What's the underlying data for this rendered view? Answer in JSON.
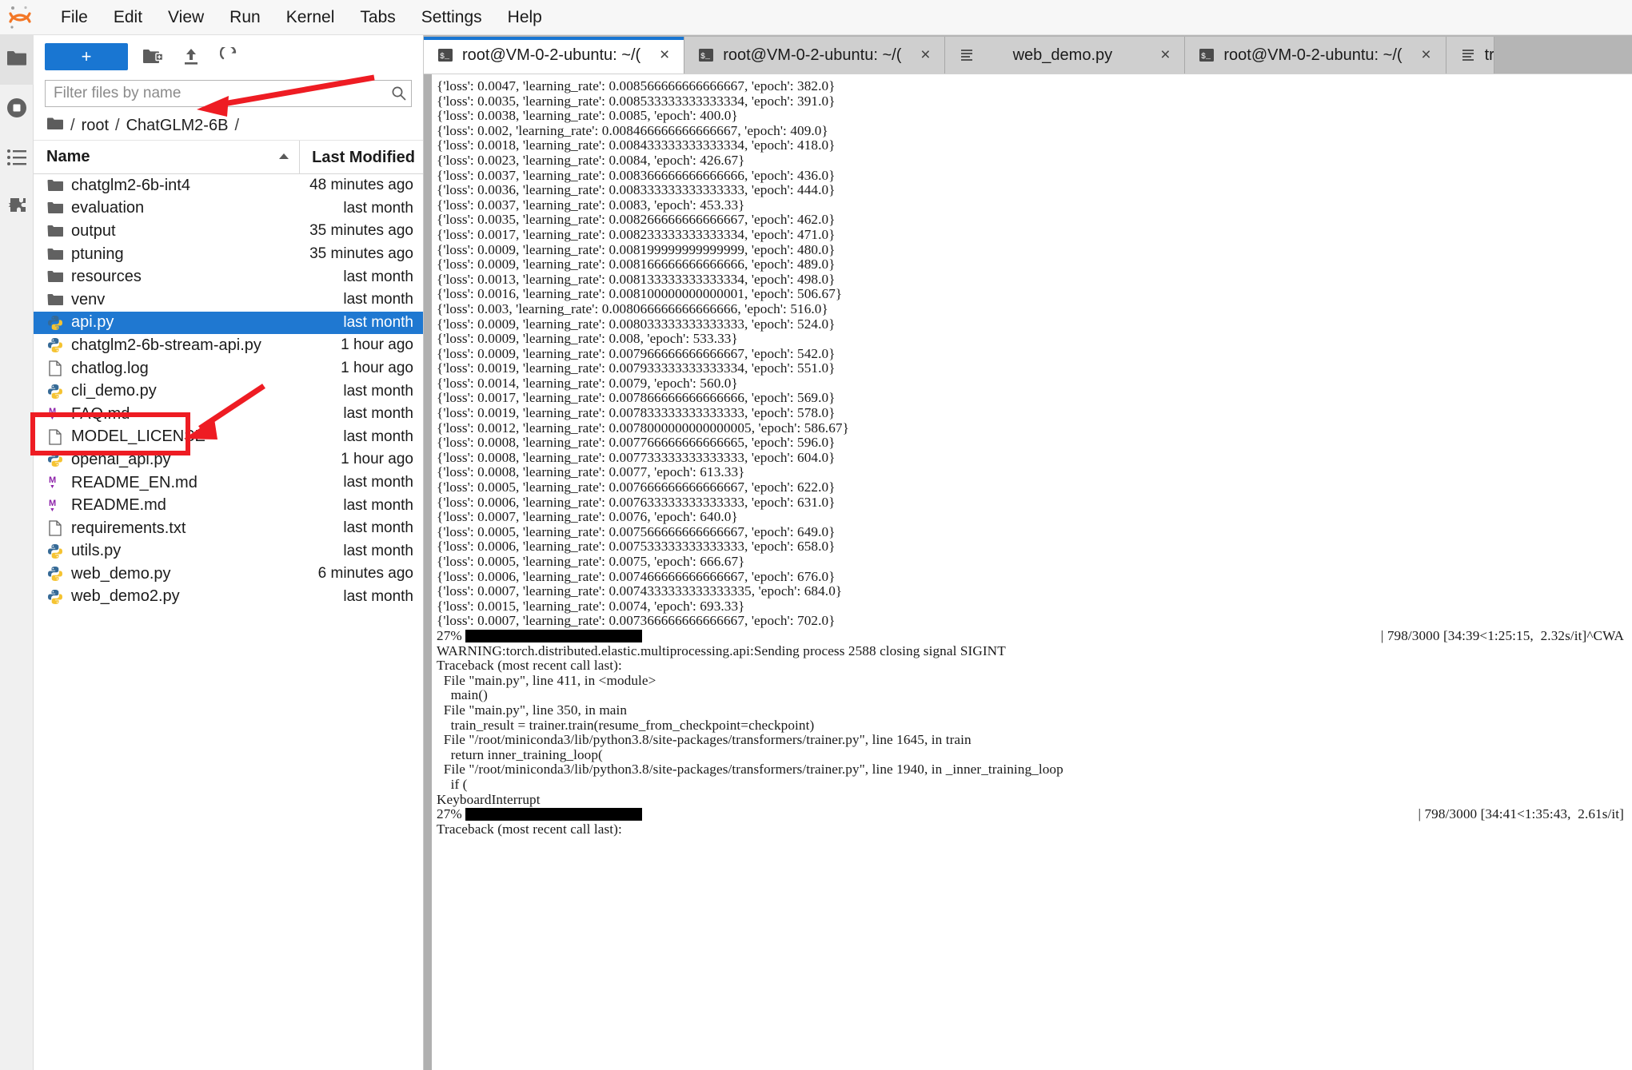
{
  "menubar": {
    "logo": "jupyter-logo",
    "items": [
      "File",
      "Edit",
      "View",
      "Run",
      "Kernel",
      "Tabs",
      "Settings",
      "Help"
    ]
  },
  "rail": {
    "items": [
      {
        "icon": "folder-icon",
        "name": "file-browser",
        "active": true
      },
      {
        "icon": "running-terminals-icon",
        "name": "running-sessions",
        "active": false
      },
      {
        "icon": "commands-list-icon",
        "name": "commands",
        "active": false
      },
      {
        "icon": "extension-puzzle-icon",
        "name": "extension-manager",
        "active": false
      }
    ]
  },
  "browser": {
    "new_launcher_label": "+",
    "toolbar_icons": [
      "new-folder-icon",
      "upload-icon",
      "refresh-icon"
    ],
    "filter": {
      "value": "",
      "placeholder": "Filter files by name"
    },
    "breadcrumb": {
      "root": "/",
      "parts": [
        "root",
        "ChatGLM2-6B"
      ],
      "trailing": "/"
    },
    "columns": {
      "name": "Name",
      "last_modified": "Last Modified",
      "sort": "ascending"
    },
    "files": [
      {
        "name": "chatglm2-6b-int4",
        "icon": "folder-icon",
        "modified": "48 minutes ago",
        "selected": false
      },
      {
        "name": "evaluation",
        "icon": "folder-icon",
        "modified": "last month",
        "selected": false
      },
      {
        "name": "output",
        "icon": "folder-icon",
        "modified": "35 minutes ago",
        "selected": false
      },
      {
        "name": "ptuning",
        "icon": "folder-icon",
        "modified": "35 minutes ago",
        "selected": false
      },
      {
        "name": "resources",
        "icon": "folder-icon",
        "modified": "last month",
        "selected": false
      },
      {
        "name": "venv",
        "icon": "folder-icon",
        "modified": "last month",
        "selected": false
      },
      {
        "name": "api.py",
        "icon": "python-icon",
        "modified": "last month",
        "selected": true
      },
      {
        "name": "chatglm2-6b-stream-api.py",
        "icon": "python-icon",
        "modified": "1 hour ago",
        "selected": false
      },
      {
        "name": "chatlog.log",
        "icon": "file-icon",
        "modified": "1 hour ago",
        "selected": false
      },
      {
        "name": "cli_demo.py",
        "icon": "python-icon",
        "modified": "last month",
        "selected": false
      },
      {
        "name": "FAQ.md",
        "icon": "markdown-icon",
        "modified": "last month",
        "selected": false
      },
      {
        "name": "MODEL_LICENSE",
        "icon": "file-icon",
        "modified": "last month",
        "selected": false
      },
      {
        "name": "openai_api.py",
        "icon": "python-icon",
        "modified": "1 hour ago",
        "selected": false
      },
      {
        "name": "README_EN.md",
        "icon": "markdown-icon",
        "modified": "last month",
        "selected": false
      },
      {
        "name": "README.md",
        "icon": "markdown-icon",
        "modified": "last month",
        "selected": false
      },
      {
        "name": "requirements.txt",
        "icon": "file-icon",
        "modified": "last month",
        "selected": false
      },
      {
        "name": "utils.py",
        "icon": "python-icon",
        "modified": "last month",
        "selected": false
      },
      {
        "name": "web_demo.py",
        "icon": "python-icon",
        "modified": "6 minutes ago",
        "selected": false
      },
      {
        "name": "web_demo2.py",
        "icon": "python-icon",
        "modified": "last month",
        "selected": false
      }
    ]
  },
  "dock": {
    "tabs": [
      {
        "label": "root@VM-0-2-ubuntu: ~/(",
        "icon": "terminal-icon",
        "close": "×",
        "active": true
      },
      {
        "label": "root@VM-0-2-ubuntu: ~/(",
        "icon": "terminal-icon",
        "close": "×",
        "active": false
      },
      {
        "label": "web_demo.py",
        "icon": "text-file-icon",
        "close": "×",
        "active": false
      },
      {
        "label": "root@VM-0-2-ubuntu: ~/(",
        "icon": "terminal-icon",
        "close": "×",
        "active": false
      },
      {
        "label": "tr",
        "icon": "text-file-icon",
        "close": "",
        "active": false
      }
    ]
  },
  "terminal": {
    "lines": [
      "{'loss': 0.0047, 'learning_rate': 0.008566666666666667, 'epoch': 382.0}",
      "{'loss': 0.0035, 'learning_rate': 0.008533333333333334, 'epoch': 391.0}",
      "{'loss': 0.0038, 'learning_rate': 0.0085, 'epoch': 400.0}",
      "{'loss': 0.002, 'learning_rate': 0.008466666666666667, 'epoch': 409.0}",
      "{'loss': 0.0018, 'learning_rate': 0.008433333333333334, 'epoch': 418.0}",
      "{'loss': 0.0023, 'learning_rate': 0.0084, 'epoch': 426.67}",
      "{'loss': 0.0037, 'learning_rate': 0.008366666666666666, 'epoch': 436.0}",
      "{'loss': 0.0036, 'learning_rate': 0.008333333333333333, 'epoch': 444.0}",
      "{'loss': 0.0037, 'learning_rate': 0.0083, 'epoch': 453.33}",
      "{'loss': 0.0035, 'learning_rate': 0.008266666666666667, 'epoch': 462.0}",
      "{'loss': 0.0017, 'learning_rate': 0.008233333333333334, 'epoch': 471.0}",
      "{'loss': 0.0009, 'learning_rate': 0.008199999999999999, 'epoch': 480.0}",
      "{'loss': 0.0009, 'learning_rate': 0.008166666666666666, 'epoch': 489.0}",
      "{'loss': 0.0013, 'learning_rate': 0.008133333333333334, 'epoch': 498.0}",
      "{'loss': 0.0016, 'learning_rate': 0.008100000000000001, 'epoch': 506.67}",
      "{'loss': 0.003, 'learning_rate': 0.008066666666666666, 'epoch': 516.0}",
      "{'loss': 0.0009, 'learning_rate': 0.008033333333333333, 'epoch': 524.0}",
      "{'loss': 0.0009, 'learning_rate': 0.008, 'epoch': 533.33}",
      "{'loss': 0.0009, 'learning_rate': 0.007966666666666667, 'epoch': 542.0}",
      "{'loss': 0.0019, 'learning_rate': 0.007933333333333334, 'epoch': 551.0}",
      "{'loss': 0.0014, 'learning_rate': 0.0079, 'epoch': 560.0}",
      "{'loss': 0.0017, 'learning_rate': 0.007866666666666666, 'epoch': 569.0}",
      "{'loss': 0.0019, 'learning_rate': 0.007833333333333333, 'epoch': 578.0}",
      "{'loss': 0.0012, 'learning_rate': 0.0078000000000000005, 'epoch': 586.67}",
      "{'loss': 0.0008, 'learning_rate': 0.007766666666666665, 'epoch': 596.0}",
      "{'loss': 0.0008, 'learning_rate': 0.007733333333333333, 'epoch': 604.0}",
      "{'loss': 0.0008, 'learning_rate': 0.0077, 'epoch': 613.33}",
      "{'loss': 0.0005, 'learning_rate': 0.007666666666666667, 'epoch': 622.0}",
      "{'loss': 0.0006, 'learning_rate': 0.007633333333333333, 'epoch': 631.0}",
      "{'loss': 0.0007, 'learning_rate': 0.0076, 'epoch': 640.0}",
      "{'loss': 0.0005, 'learning_rate': 0.007566666666666667, 'epoch': 649.0}",
      "{'loss': 0.0006, 'learning_rate': 0.007533333333333333, 'epoch': 658.0}",
      "{'loss': 0.0005, 'learning_rate': 0.0075, 'epoch': 666.67}",
      "{'loss': 0.0006, 'learning_rate': 0.007466666666666667, 'epoch': 676.0}",
      "{'loss': 0.0007, 'learning_rate': 0.0074333333333333335, 'epoch': 684.0}",
      "{'loss': 0.0015, 'learning_rate': 0.0074, 'epoch': 693.33}",
      "{'loss': 0.0007, 'learning_rate': 0.007366666666666667, 'epoch': 702.0}"
    ],
    "progress1": {
      "percent": "27%",
      "right": "| 798/3000 [34:39<1:25:15,  2.32s/it]^CWA"
    },
    "after_progress1": [
      "WARNING:torch.distributed.elastic.multiprocessing.api:Sending process 2588 closing signal SIGINT",
      "Traceback (most recent call last):",
      "  File \"main.py\", line 411, in <module>",
      "    main()",
      "  File \"main.py\", line 350, in main",
      "    train_result = trainer.train(resume_from_checkpoint=checkpoint)",
      "  File \"/root/miniconda3/lib/python3.8/site-packages/transformers/trainer.py\", line 1645, in train",
      "    return inner_training_loop(",
      "  File \"/root/miniconda3/lib/python3.8/site-packages/transformers/trainer.py\", line 1940, in _inner_training_loop",
      "    if (",
      "KeyboardInterrupt"
    ],
    "progress2": {
      "percent": "27%",
      "right": "| 798/3000 [34:41<1:35:43,  2.61s/it]"
    },
    "after_progress2": [
      "Traceback (most recent call last):"
    ]
  },
  "annotations": {
    "color": "#ee1c23",
    "arrow_to_breadcrumb": "arrow-pointing-to-breadcrumb",
    "arrow_to_openai_api": "arrow-pointing-to-openai-api-py",
    "highlight_box": "red-box-around-openai-api-py"
  },
  "colors": {
    "accent": "#1976d2",
    "selection": "#1f78d1",
    "annotation_red": "#ee1c23",
    "tabbar_bg": "#b5b5b5"
  }
}
